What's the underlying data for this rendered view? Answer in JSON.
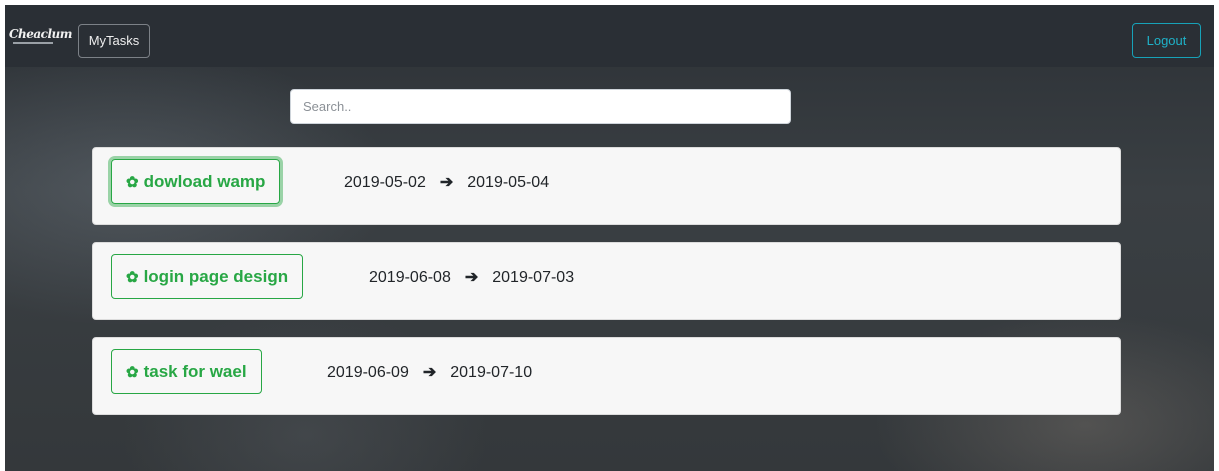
{
  "navbar": {
    "logo_text": "Cheaclum",
    "mytasks_label": "MyTasks",
    "logout_label": "Logout"
  },
  "search": {
    "placeholder": "Search.."
  },
  "tasks": [
    {
      "name": "dowload wamp",
      "start": "2019-05-02",
      "end": "2019-05-04"
    },
    {
      "name": "login page design",
      "start": "2019-06-08",
      "end": "2019-07-03"
    },
    {
      "name": "task for wael",
      "start": "2019-06-09",
      "end": "2019-07-10"
    }
  ],
  "icons": {
    "task": "gear-icon",
    "date_separator": "arrow-right-icon"
  },
  "colors": {
    "success": "#28a745",
    "info": "#17a2b8",
    "navbar": "#2a2f35"
  }
}
